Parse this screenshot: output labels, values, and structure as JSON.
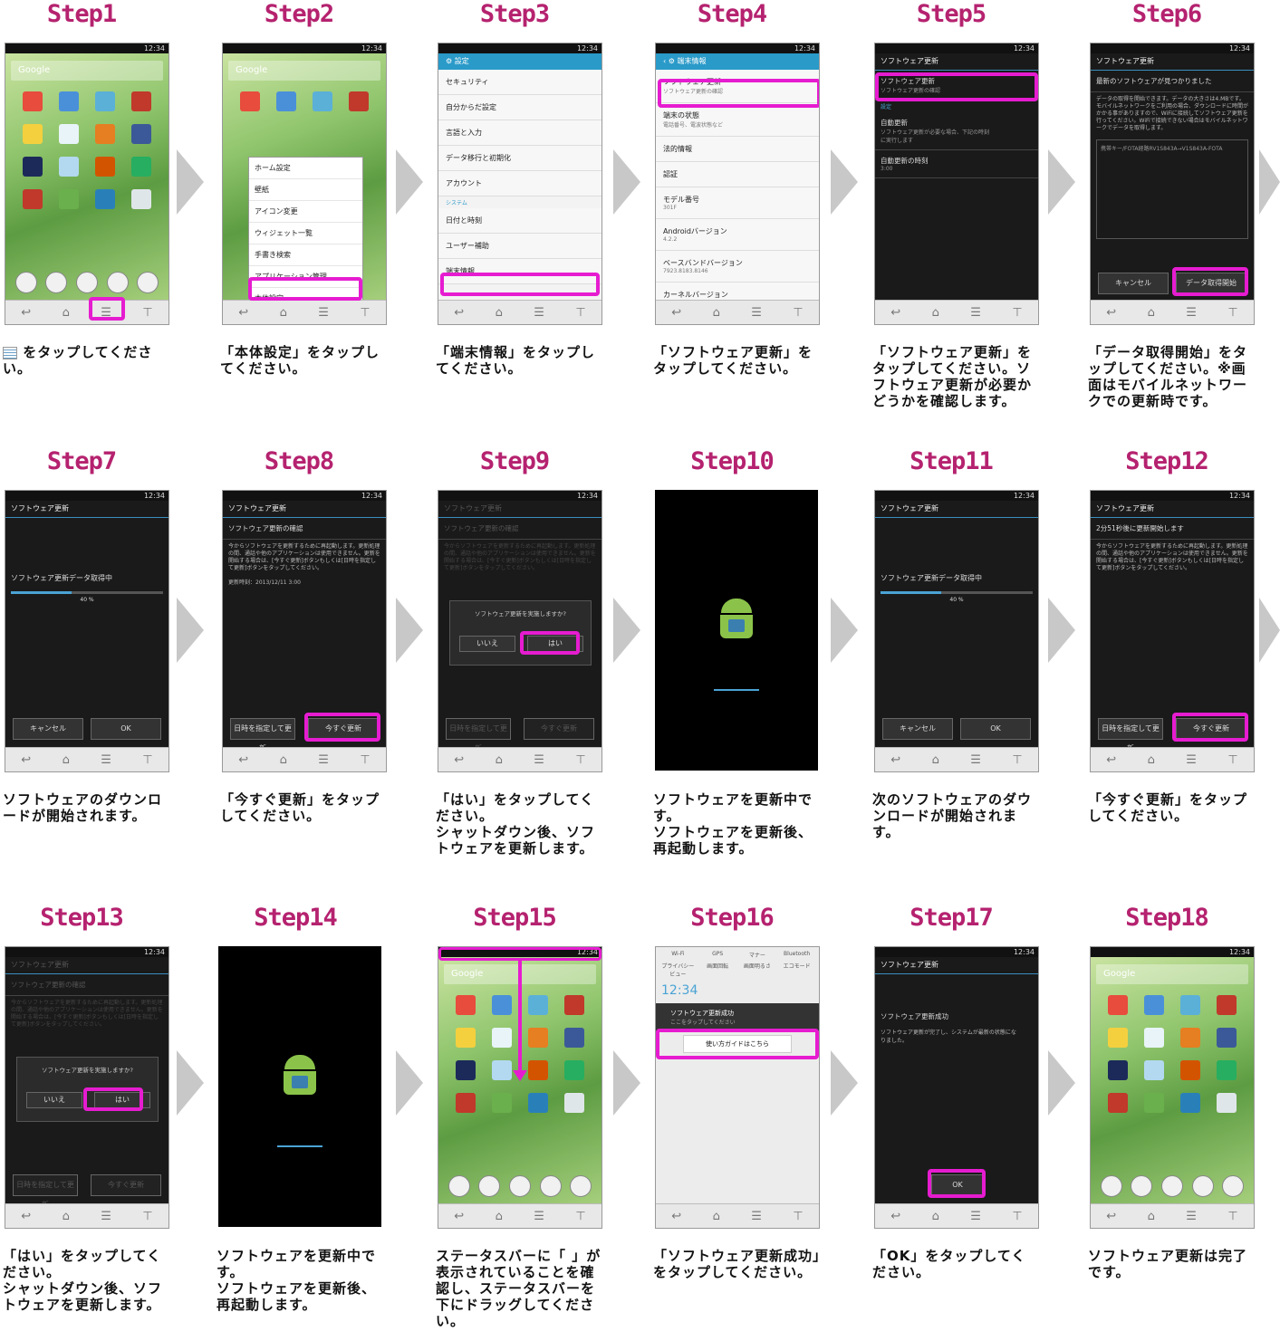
{
  "colors": {
    "accent": "#e61cd0",
    "title": "#b5226f",
    "arrow": "#c8c8c8"
  },
  "status_time": "12:34",
  "steps": [
    {
      "title": "Step1",
      "caption": " をタップしてください。"
    },
    {
      "title": "Step2",
      "caption": "「本体設定」をタップしてください。"
    },
    {
      "title": "Step3",
      "caption": "「端末情報」をタップしてください。"
    },
    {
      "title": "Step4",
      "caption": "「ソフトウェア更新」をタップしてください。"
    },
    {
      "title": "Step5",
      "caption": "「ソフトウェア更新」をタップしてください。ソフトウェア更新が必要かどうかを確認します。"
    },
    {
      "title": "Step6",
      "caption": "「データ取得開始」をタップしてください。※画面はモバイルネットワークでの更新時です。"
    },
    {
      "title": "Step7",
      "caption": "ソフトウェアのダウンロードが開始されます。"
    },
    {
      "title": "Step8",
      "caption": "「今すぐ更新」をタップしてください。"
    },
    {
      "title": "Step9",
      "caption": "「はい」をタップしてください。\nシャットダウン後、ソフトウェアを更新します。"
    },
    {
      "title": "Step10",
      "caption": "ソフトウェアを更新中です。\nソフトウェアを更新後、再起動します。"
    },
    {
      "title": "Step11",
      "caption": "次のソフトウェアのダウンロードが開始されます。"
    },
    {
      "title": "Step12",
      "caption": "「今すぐ更新」をタップしてください。"
    },
    {
      "title": "Step13",
      "caption": "「はい」をタップしてください。\nシャットダウン後、ソフトウェアを更新します。"
    },
    {
      "title": "Step14",
      "caption": "ソフトウェアを更新中です。\nソフトウェアを更新後、再起動します。"
    },
    {
      "title": "Step15",
      "caption": "ステータスバーに「 」が表示されていることを確認し、ステータスバーを下にドラッグしてください。"
    },
    {
      "title": "Step16",
      "caption": "「ソフトウェア更新成功」をタップしてください。"
    },
    {
      "title": "Step17",
      "caption": "「OK」をタップしてください。"
    },
    {
      "title": "Step18",
      "caption": "ソフトウェア更新は完了です。"
    }
  ],
  "screens": {
    "google": "Google",
    "menu": [
      "ホーム設定",
      "壁紙",
      "アイコン変更",
      "ウィジェット一覧",
      "手書き検索",
      "アプリケーション管理",
      "本体設定"
    ],
    "settings_title": "設定",
    "settings": [
      "セキュリティ",
      "自分からだ設定",
      "言語と入力",
      "データ移行と初期化",
      "アカウント",
      "システム",
      "日付と時刻",
      "ユーザー補助",
      "端末情報"
    ],
    "about_title": "端末情報",
    "about": [
      [
        "ソフトウェア更新",
        "ソフトウェア更新の確認"
      ],
      [
        "端末の状態",
        "電話番号、電波状態など"
      ],
      [
        "法的情報",
        ""
      ],
      [
        "認証",
        ""
      ],
      [
        "モデル番号",
        "301F"
      ],
      [
        "Androidバージョン",
        "4.2.2"
      ],
      [
        "ベースバンドバージョン",
        "7923.8183.8146"
      ],
      [
        "カーネルバージョン",
        ""
      ]
    ],
    "sw_update": "ソフトウェア更新",
    "sw_update_sub": "ソフトウェア更新の確認",
    "settings_label": "設定",
    "auto_update": "自動更新",
    "auto_update_sub": "ソフトウェア更新が必要な場合、下記の時刻に実行します",
    "auto_update_time": "自動更新の時刻",
    "auto_update_time_val": "3:00",
    "found": "最新のソフトウェアが見つかりました",
    "found_body": "データの取得を開始できます。データの大きさは4.MBです。モバイルネットワークをご利用の場合、ダウンロードに時間がかかる事がありますので、WiFiに接続してソフトウェア更新を行ってください。WiFiで接続できない場合はモバイルネットワークでデータを取得します。",
    "file_name": "携帯キー/FOTA経路RV1S843A→V1S843A-FOTA",
    "cancel": "キャンセル",
    "start_fetch": "データ取得開始",
    "fetching": "ソフトウェア更新データ取得中",
    "percent": "40 %",
    "progress": 0.4,
    "ok": "OK",
    "confirm": "ソフトウェア更新の確認",
    "confirm_body": "今からソフトウェアを更新するために再起動します。更新処理の間、通話や他のアプリケーションは使用できません。更新を開始する場合は、[今すぐ更新]ボタンもしくは[日時を指定して更新]ボタンをタップしてください。",
    "update_time": "更新時刻：2013/12/11 3:00",
    "schedule": "日時を指定して更新",
    "update_now": "今すぐ更新",
    "dialog_q": "ソフトウェア更新を実施しますか?",
    "no": "いいえ",
    "yes": "はい",
    "countdown": "2分51秒後に更新開始します",
    "qs": [
      "Wi-Fi",
      "GPS",
      "マナー",
      "Bluetooth",
      "プライバシービュー",
      "画面回転",
      "画面明るさ",
      "エコモード"
    ],
    "notif_time": "12:34",
    "notif_title": "ソフトウェア更新成功",
    "notif_sub": "ここをタップしてください",
    "guide": "使い方ガイドはこちら",
    "success": "ソフトウェア更新成功",
    "success_body": "ソフトウェア更新が完了し、システムが最新の状態になりました。"
  }
}
